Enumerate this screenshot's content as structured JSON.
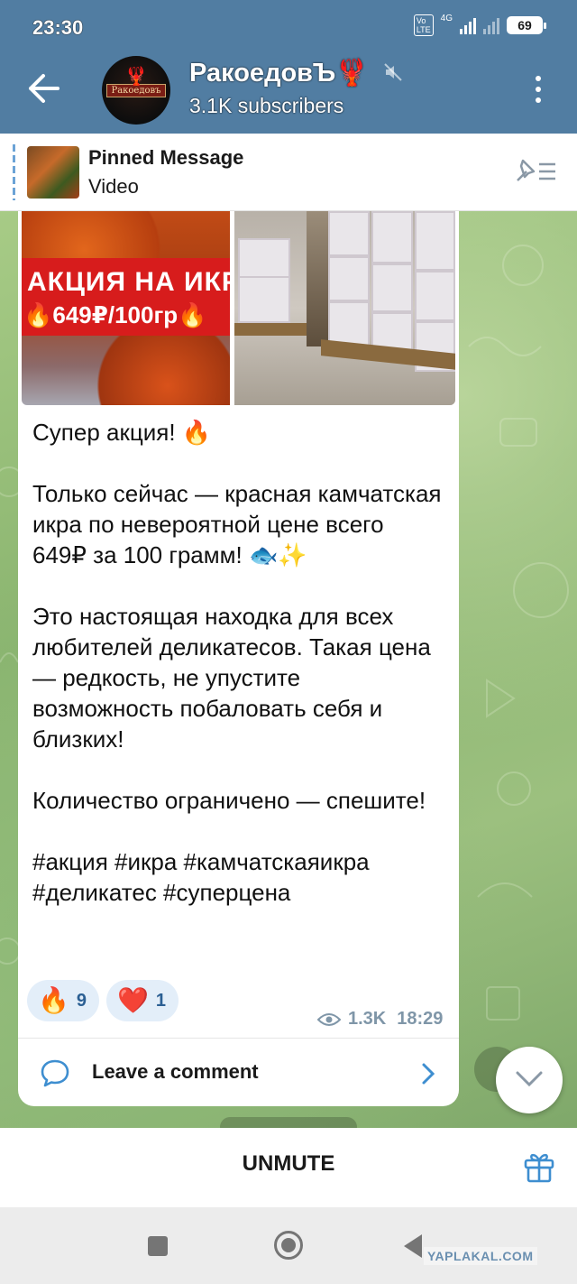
{
  "status_bar": {
    "time": "23:30",
    "volte_label": "Vo\nLTE",
    "network_label": "4G",
    "battery": "69"
  },
  "header": {
    "channel_name": "РакоедовЪ🦞",
    "subscribers": "3.1K subscribers",
    "avatar_text": "Ракоедовъ",
    "accent_color": "#517da2"
  },
  "pinned": {
    "title": "Pinned Message",
    "subtitle": "Video"
  },
  "post": {
    "image1": {
      "line1": "АКЦИЯ НА ИКРУ",
      "line2": "🔥649₽/100гр🔥"
    },
    "paragraphs": [
      "Супер акция! 🔥",
      "Только сейчас — красная камчатская икра по невероятной цене всего\n649₽ за 100 грамм! 🐟✨",
      "Это настоящая находка для всех любителей деликатесов. Такая цена — редкость, не упустите возможность побаловать себя и близких!",
      "Количество ограничено — спешите!",
      "#акция #икра #камчатскаяикра #деликатес #суперцена"
    ],
    "reactions": [
      {
        "emoji": "🔥",
        "count": "9"
      },
      {
        "emoji": "❤️",
        "count": "1"
      }
    ],
    "views": "1.3K",
    "time": "18:29",
    "comment_label": "Leave a comment"
  },
  "bottom_bar": {
    "unmute_label": "UNMUTE"
  },
  "watermark": "YAPLAKAL.COM"
}
